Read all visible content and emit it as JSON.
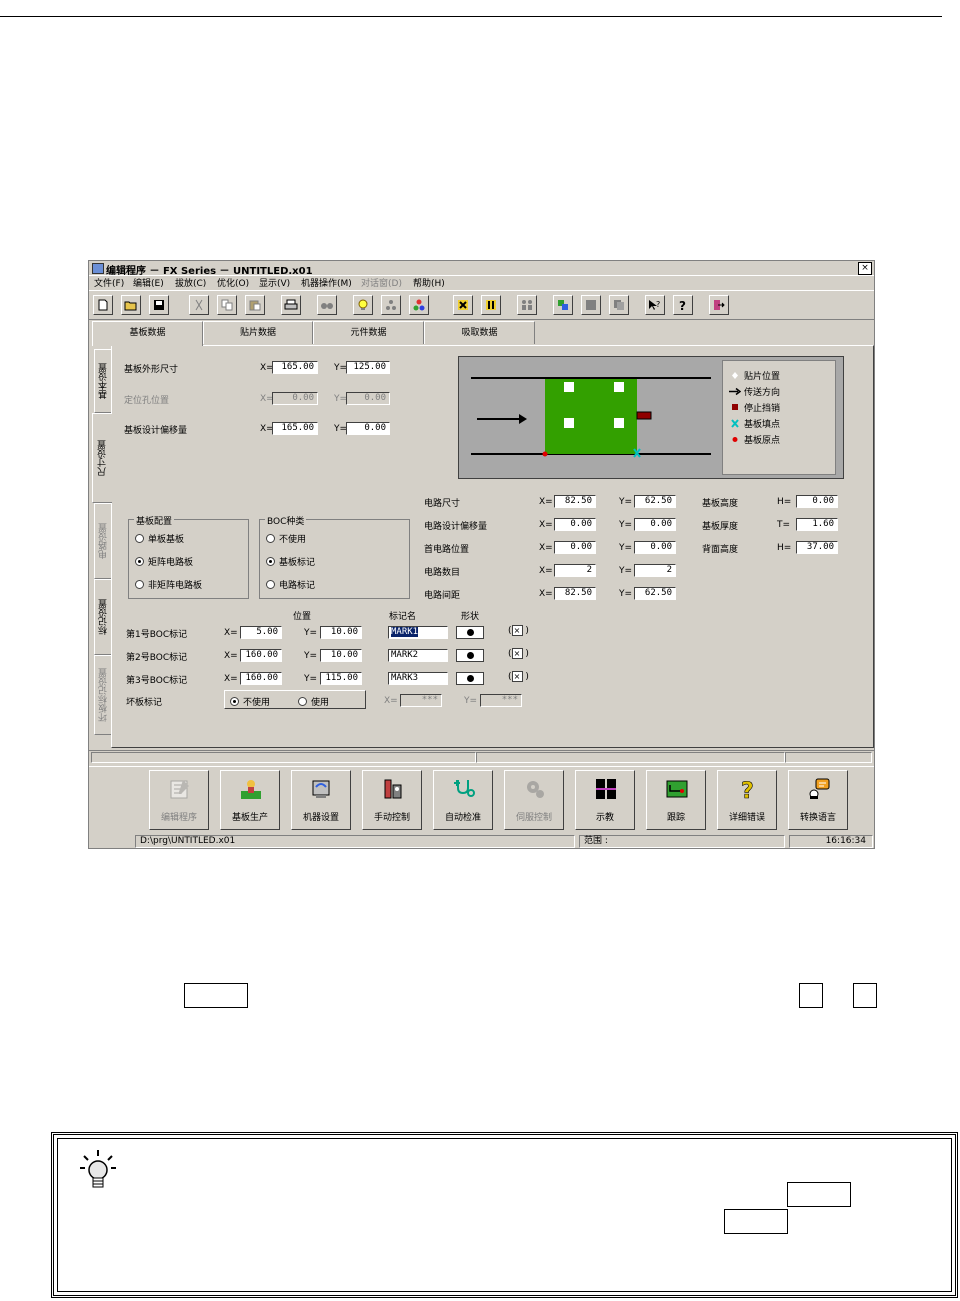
{
  "window": {
    "title": "编辑程序 － FX Series － UNTITLED.x01",
    "close_glyph": "×"
  },
  "menu": [
    "文件(F)",
    "编辑(E)",
    "拔放(C)",
    "优化(O)",
    "显示(V)",
    "机器操作(M)",
    "对话窗(D)",
    "帮助(H)"
  ],
  "toolbar_icons": [
    "new-file-icon",
    "open-folder-icon",
    "save-icon",
    "cut-icon",
    "copy-icon",
    "paste-icon",
    "print-icon",
    "find-icon",
    "light-bulb-icon",
    "tree-icon",
    "balls-icon",
    "align-icon",
    "column-icon",
    "people-icon",
    "color-block-icon",
    "stop-icon",
    "pages-icon",
    "pointer-help-icon",
    "help-icon",
    "exit-icon"
  ],
  "tabs": [
    "基板数据",
    "贴片数据",
    "元件数据",
    "吸取数据"
  ],
  "side_tabs": [
    "基本设置",
    "尺寸设置",
    "电路设置",
    "标记设置",
    "坏板标记设置"
  ],
  "board": {
    "outline_label": "基板外形尺寸",
    "outline_x": "165.00",
    "outline_y": "125.00",
    "hole_label": "定位孔位置",
    "hole_x": "0.00",
    "hole_y": "0.00",
    "offset_label": "基板设计偏移量",
    "offset_x": "165.00",
    "offset_y": "0.00",
    "x_prefix": "X=",
    "y_prefix": "Y="
  },
  "legend": [
    "贴片位置",
    "传送方向",
    "停止挡销",
    "基板填点",
    "基板原点"
  ],
  "circuit": {
    "size_label": "电路尺寸",
    "size_x": "82.50",
    "size_y": "62.50",
    "offset_label": "电路设计偏移量",
    "offset_x": "0.00",
    "offset_y": "0.00",
    "first_label": "首电路位置",
    "first_x": "0.00",
    "first_y": "0.00",
    "count_label": "电路数目",
    "count_x": "2",
    "count_y": "2",
    "pitch_label": "电路间距",
    "pitch_x": "82.50",
    "pitch_y": "62.50"
  },
  "heights": {
    "board_h_label": "基板高度",
    "board_h_prefix": "H=",
    "board_h": "0.00",
    "thick_label": "基板厚度",
    "thick_prefix": "T=",
    "thick": "1.60",
    "back_label": "背面高度",
    "back_prefix": "H=",
    "back": "37.00"
  },
  "config_group": {
    "title": "基板配置",
    "options": [
      "单板基板",
      "矩阵电路板",
      "非矩阵电路板"
    ],
    "selected": 1
  },
  "boc_group": {
    "title": "BOC种类",
    "options": [
      "不使用",
      "基板标记",
      "电路标记"
    ],
    "selected": 1
  },
  "marks": {
    "pos_header": "位置",
    "name_header": "标记名",
    "shape_header": "形状",
    "rows": [
      {
        "label": "第1号BOC标记",
        "x": "5.00",
        "y": "10.00",
        "name": "MARK1",
        "check": "×"
      },
      {
        "label": "第2号BOC标记",
        "x": "160.00",
        "y": "10.00",
        "name": "MARK2",
        "check": "×"
      },
      {
        "label": "第3号BOC标记",
        "x": "160.00",
        "y": "115.00",
        "name": "MARK3",
        "check": "×"
      }
    ],
    "check_open": "(",
    "check_close": ")"
  },
  "bad_mark": {
    "label": "坏板标记",
    "opt1": "不使用",
    "opt2": "使用",
    "x": "***",
    "y": "***",
    "x_prefix": "X=",
    "y_prefix": "Y="
  },
  "bottom_buttons": [
    {
      "label": "编辑程序",
      "icon": "edit-program-icon",
      "disabled": true
    },
    {
      "label": "基板生产",
      "icon": "production-icon",
      "disabled": false
    },
    {
      "label": "机器设置",
      "icon": "machine-setup-icon",
      "disabled": false
    },
    {
      "label": "手动控制",
      "icon": "manual-control-icon",
      "disabled": false
    },
    {
      "label": "自动检准",
      "icon": "auto-check-icon",
      "disabled": false
    },
    {
      "label": "伺服控制",
      "icon": "servo-control-icon",
      "disabled": true
    },
    {
      "label": "示教",
      "icon": "teach-icon",
      "disabled": false
    },
    {
      "label": "跟踪",
      "icon": "trace-icon",
      "disabled": false
    },
    {
      "label": "详细错误",
      "icon": "error-detail-icon",
      "disabled": false
    },
    {
      "label": "转换语言",
      "icon": "language-icon",
      "disabled": false
    }
  ],
  "status": {
    "path": "D:\\prg\\UNTITLED.x01",
    "range": "范围 :",
    "time": "16:16:34"
  }
}
